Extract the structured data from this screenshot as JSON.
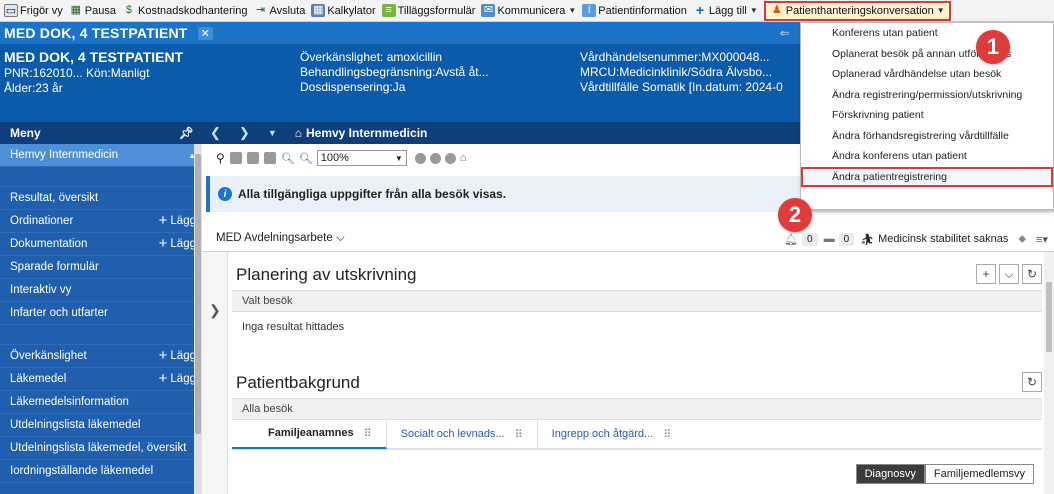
{
  "toolbar": {
    "items": [
      {
        "label": "Frigör vy",
        "icon": "monitor-icon"
      },
      {
        "label": "Pausa",
        "icon": "pause-grid-icon"
      },
      {
        "label": "Kostnadskodhantering",
        "icon": "cost-icon"
      },
      {
        "label": "Avsluta",
        "icon": "exit-icon"
      },
      {
        "label": "Kalkylator",
        "icon": "calculator-icon"
      },
      {
        "label": "Tilläggsformulär",
        "icon": "form-icon"
      },
      {
        "label": "Kommunicera",
        "icon": "communicate-icon",
        "caret": true
      },
      {
        "label": "Patientinformation",
        "icon": "info-icon"
      },
      {
        "label": "Lägg till",
        "icon": "plus-icon",
        "caret": true
      }
    ],
    "highlight_item": "Patienthanteringskonversation"
  },
  "patient": {
    "tab_label": "MED DOK, 4 TESTPATIENT",
    "name": "MED DOK, 4 TESTPATIENT",
    "pnr_line": "PNR:162010... Kön:Manligt",
    "age_line": "Ålder:23 år",
    "col2": [
      "Överkänslighet: amoxicillin",
      "Behandlingsbegränsning:Avstå åt...",
      "Dosdispensering:Ja"
    ],
    "col3": [
      "Vårdhändelsenummer:MX000048...",
      "MRCU:Medicinklinik/Södra Älvsbo...",
      "Vårdtillfälle Somatik [In.datum: 2024-0"
    ]
  },
  "sidebar": {
    "header": "Meny",
    "items": [
      {
        "label": "Hemvy Internmedicin",
        "active": true,
        "add": ""
      },
      {
        "spacer": true
      },
      {
        "label": "Resultat, översikt",
        "add": ""
      },
      {
        "label": "Ordinationer",
        "add": "Lägg"
      },
      {
        "label": "Dokumentation",
        "add": "Lägg"
      },
      {
        "label": "Sparade formulär",
        "add": ""
      },
      {
        "label": "Interaktiv vy",
        "add": ""
      },
      {
        "label": "Infarter och utfarter",
        "add": ""
      },
      {
        "spacer": true
      },
      {
        "label": "Överkänslighet",
        "add": "Lägg"
      },
      {
        "label": "Läkemedel",
        "add": "Lägg"
      },
      {
        "label": "Läkemedelsinformation",
        "add": ""
      },
      {
        "label": "Utdelningslista läkemedel",
        "add": ""
      },
      {
        "label": "Utdelningslista läkemedel, översikt",
        "add": ""
      },
      {
        "label": "Iordningställande läkemedel",
        "add": ""
      }
    ]
  },
  "nav": {
    "title": "Hemvy Internmedicin"
  },
  "content_toolbar": {
    "zoom": "100%"
  },
  "info_banner": "Alla tillgängliga uppgifter från alla besök visas.",
  "worklist": {
    "label": "MED Avdelningsarbete",
    "count1": "0",
    "count2": "0",
    "status": "Medicinsk stabilitet saknas"
  },
  "panels": {
    "planning": {
      "title": "Planering av utskrivning",
      "sub": "Valt besök",
      "empty": "Inga resultat hittades"
    },
    "background": {
      "title": "Patientbakgrund",
      "sub": "Alla besök"
    }
  },
  "tabs": [
    {
      "label": "Familjeanamnes",
      "active": true
    },
    {
      "label": "Socialt och levnads...",
      "active": false
    },
    {
      "label": "Ingrepp och åtgärd...",
      "active": false
    }
  ],
  "view_toggle": {
    "diagnos": "Diagnosvy",
    "familj": "Familjemedlemsvy"
  },
  "dropdown": {
    "items": [
      "Konferens utan patient",
      "Oplanerat besök på annan utförarplats",
      "Oplanerad vårdhändelse utan besök",
      "Ändra registrering/permission/utskrivning",
      "Förskrivning patient",
      "Ändra förhandsregistrering vårdtillfälle",
      "Ändra konferens utan patient",
      "Ändra patientregistrering"
    ],
    "highlight_index": 7
  },
  "callouts": [
    "1",
    "2"
  ],
  "colors": {
    "header_blue": "#0c5bab",
    "sidebar_blue": "#1f5fae",
    "highlight_red": "#d93a3a"
  }
}
